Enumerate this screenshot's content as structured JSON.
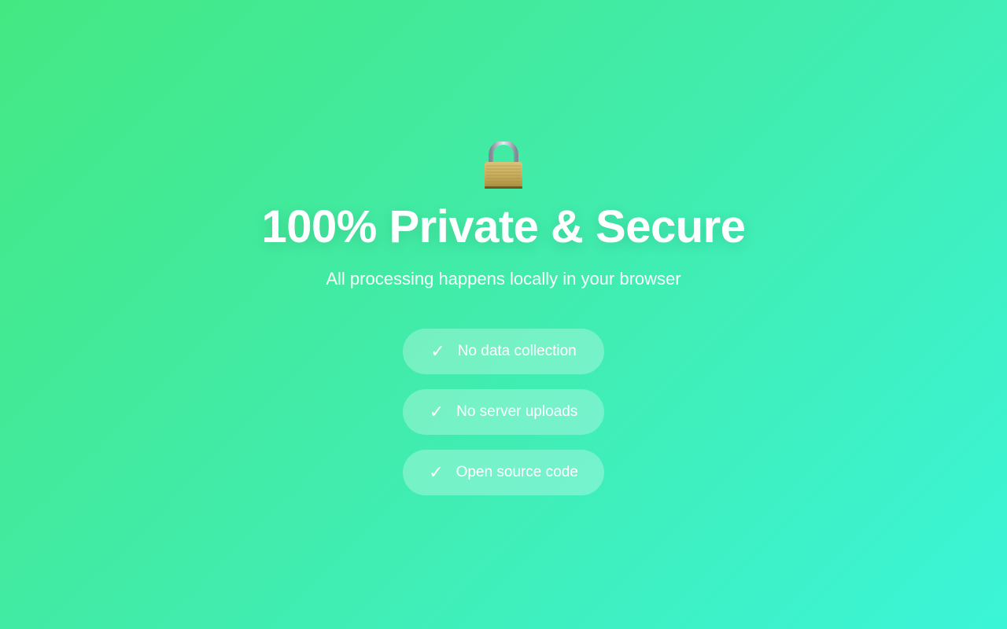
{
  "hero": {
    "icon": "lock-icon",
    "title": "100% Private & Secure",
    "subtitle": "All processing happens locally in your browser"
  },
  "features": [
    {
      "icon": "checkmark-icon",
      "check": "✓",
      "label": "No data collection"
    },
    {
      "icon": "checkmark-icon",
      "check": "✓",
      "label": "No server uploads"
    },
    {
      "icon": "checkmark-icon",
      "check": "✓",
      "label": "Open source code"
    }
  ],
  "colors": {
    "gradient_start": "#44e882",
    "gradient_end": "#3bf5d8",
    "text": "#ffffff"
  }
}
